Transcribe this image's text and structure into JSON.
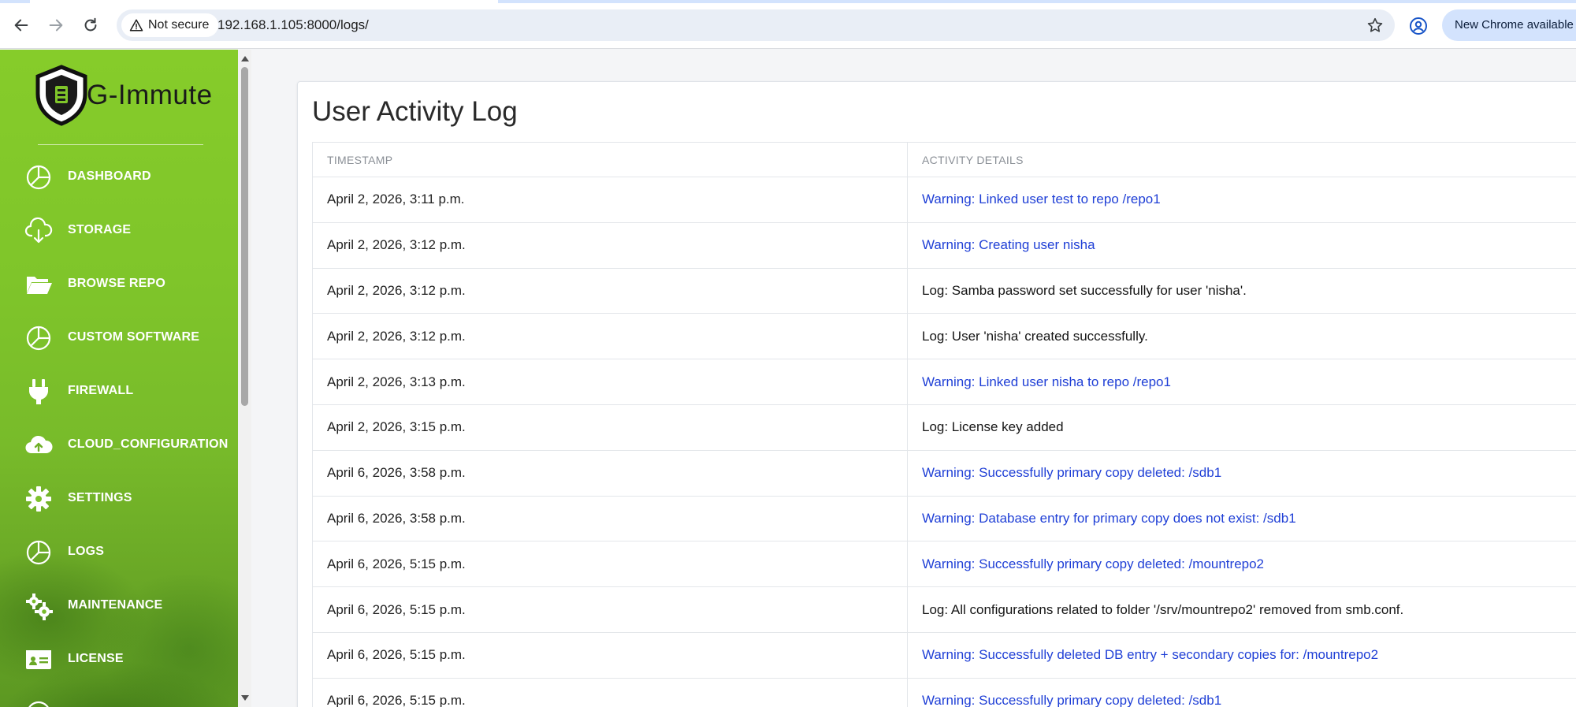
{
  "browser": {
    "security_label": "Not secure",
    "url": "192.168.1.105:8000/logs/",
    "update_label": "New Chrome available"
  },
  "brand": {
    "name": "G-Immute"
  },
  "sidebar": {
    "items": [
      {
        "label": "DASHBOARD",
        "icon": "pie-chart-icon"
      },
      {
        "label": "STORAGE",
        "icon": "cloud-download-icon"
      },
      {
        "label": "BROWSE REPO",
        "icon": "folder-open-icon"
      },
      {
        "label": "CUSTOM SOFTWARE",
        "icon": "pie-chart-icon"
      },
      {
        "label": "FIREWALL",
        "icon": "plug-icon"
      },
      {
        "label": "CLOUD_CONFIGURATION",
        "icon": "cloud-upload-icon"
      },
      {
        "label": "SETTINGS",
        "icon": "gear-icon"
      },
      {
        "label": "LOGS",
        "icon": "pie-chart-icon"
      },
      {
        "label": "MAINTENANCE",
        "icon": "gears-icon"
      },
      {
        "label": "LICENSE",
        "icon": "id-card-icon"
      }
    ]
  },
  "page": {
    "title": "User Activity Log",
    "columns": [
      "TIMESTAMP",
      "ACTIVITY DETAILS"
    ],
    "rows": [
      {
        "timestamp": "April 2, 2026, 3:11 p.m.",
        "details": "Warning: Linked user test to repo /repo1",
        "level": "warning"
      },
      {
        "timestamp": "April 2, 2026, 3:12 p.m.",
        "details": "Warning: Creating user nisha",
        "level": "warning"
      },
      {
        "timestamp": "April 2, 2026, 3:12 p.m.",
        "details": "Log: Samba password set successfully for user 'nisha'.",
        "level": "log"
      },
      {
        "timestamp": "April 2, 2026, 3:12 p.m.",
        "details": "Log: User 'nisha' created successfully.",
        "level": "log"
      },
      {
        "timestamp": "April 2, 2026, 3:13 p.m.",
        "details": "Warning: Linked user nisha to repo /repo1",
        "level": "warning"
      },
      {
        "timestamp": "April 2, 2026, 3:15 p.m.",
        "details": "Log: License key added",
        "level": "log"
      },
      {
        "timestamp": "April 6, 2026, 3:58 p.m.",
        "details": "Warning: Successfully primary copy deleted: /sdb1",
        "level": "warning"
      },
      {
        "timestamp": "April 6, 2026, 3:58 p.m.",
        "details": "Warning: Database entry for primary copy does not exist: /sdb1",
        "level": "warning"
      },
      {
        "timestamp": "April 6, 2026, 5:15 p.m.",
        "details": "Warning: Successfully primary copy deleted: /mountrepo2",
        "level": "warning"
      },
      {
        "timestamp": "April 6, 2026, 5:15 p.m.",
        "details": "Log: All configurations related to folder '/srv/mountrepo2' removed from smb.conf.",
        "level": "log"
      },
      {
        "timestamp": "April 6, 2026, 5:15 p.m.",
        "details": "Warning: Successfully deleted DB entry + secondary copies for: /mountrepo2",
        "level": "warning"
      },
      {
        "timestamp": "April 6, 2026, 5:15 p.m.",
        "details": "Warning: Successfully primary copy deleted: /sdb1",
        "level": "warning"
      }
    ]
  },
  "colors": {
    "sidebar_green": "#7fc52a",
    "warning_text": "#1f3fd6",
    "log_text": "#151515"
  }
}
